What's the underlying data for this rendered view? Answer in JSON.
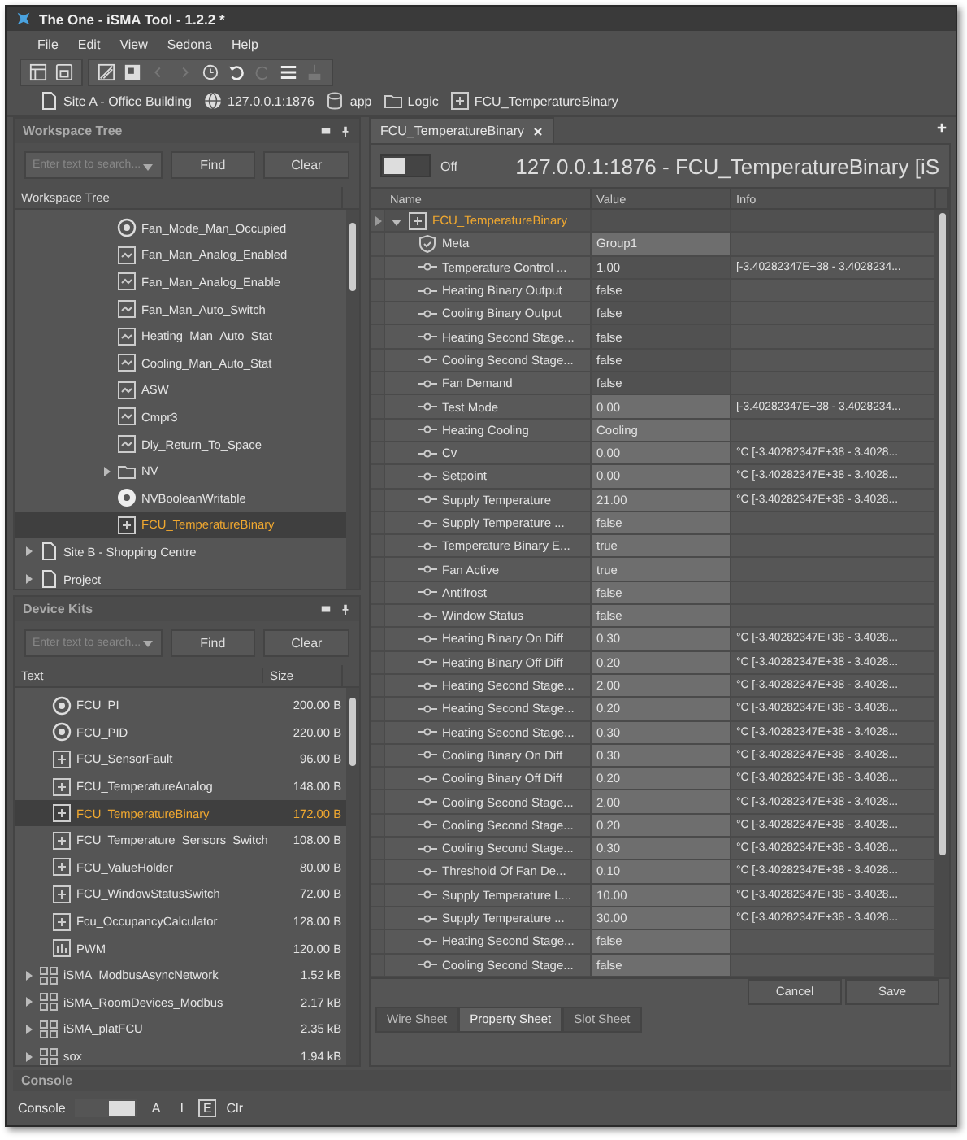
{
  "window": {
    "title": "The One - iSMA Tool - 1.2.2 *"
  },
  "menu": [
    "File",
    "Edit",
    "View",
    "Sedona",
    "Help"
  ],
  "breadcrumb": [
    {
      "label": "Site A - Office Building",
      "kind": "page"
    },
    {
      "label": "127.0.0.1:1876",
      "kind": "device"
    },
    {
      "label": "app",
      "kind": "database"
    },
    {
      "label": "Logic",
      "kind": "folder"
    },
    {
      "label": "FCU_TemperatureBinary",
      "kind": "component"
    }
  ],
  "workspace_tree": {
    "title": "Workspace Tree",
    "search": {
      "placeholder": "Enter text to search..."
    },
    "find": "Find",
    "clear": "Clear",
    "columns": [
      "Workspace Tree"
    ],
    "branch_items": [
      {
        "label": "Fan_Mode_Man_Occupied",
        "kind": "numeric",
        "selected": false
      },
      {
        "label": "Fan_Man_Analog_Enabled",
        "kind": "logic",
        "selected": false
      },
      {
        "label": "Fan_Man_Analog_Enable",
        "kind": "logic",
        "selected": false
      },
      {
        "label": "Fan_Man_Auto_Switch",
        "kind": "logic",
        "selected": false
      },
      {
        "label": "Heating_Man_Auto_Stat",
        "kind": "logic",
        "selected": false
      },
      {
        "label": "Cooling_Man_Auto_Stat",
        "kind": "logic",
        "selected": false
      },
      {
        "label": "ASW",
        "kind": "logic",
        "selected": false
      },
      {
        "label": "Cmpr3",
        "kind": "logic",
        "selected": false
      },
      {
        "label": "Dly_Return_To_Space",
        "kind": "logic",
        "selected": false
      },
      {
        "label": "NV",
        "kind": "folder",
        "expanded": false,
        "selected": false
      },
      {
        "label": "NVBooleanWritable",
        "kind": "boolean",
        "selected": false
      },
      {
        "label": "FCU_TemperatureBinary",
        "kind": "component",
        "selected": true
      }
    ],
    "root_items": [
      {
        "label": "Site B - Shopping Centre",
        "kind": "page",
        "expanded": false,
        "selected": false
      },
      {
        "label": "Project",
        "kind": "page",
        "expanded": false,
        "selected": false
      }
    ]
  },
  "device_kits": {
    "title": "Device Kits",
    "search": {
      "placeholder": "Enter text to search..."
    },
    "find": "Find",
    "clear": "Clear",
    "columns": [
      "Text",
      "Size"
    ],
    "branch_items": [
      {
        "label": "FCU_PI",
        "size": "200.00 B",
        "kind": "numeric",
        "selected": false
      },
      {
        "label": "FCU_PID",
        "size": "220.00 B",
        "kind": "numeric",
        "selected": false
      },
      {
        "label": "FCU_SensorFault",
        "size": "96.00 B",
        "kind": "component",
        "selected": false
      },
      {
        "label": "FCU_TemperatureAnalog",
        "size": "148.00 B",
        "kind": "component",
        "selected": false
      },
      {
        "label": "FCU_TemperatureBinary",
        "size": "172.00 B",
        "kind": "component",
        "selected": true
      },
      {
        "label": "FCU_Temperature_Sensors_Switch",
        "size": "108.00 B",
        "kind": "component",
        "selected": false
      },
      {
        "label": "FCU_ValueHolder",
        "size": "80.00 B",
        "kind": "component",
        "selected": false
      },
      {
        "label": "FCU_WindowStatusSwitch",
        "size": "72.00 B",
        "kind": "component",
        "selected": false
      },
      {
        "label": "Fcu_OccupancyCalculator",
        "size": "128.00 B",
        "kind": "component",
        "selected": false
      },
      {
        "label": "PWM",
        "size": "120.00 B",
        "kind": "pwm",
        "selected": false
      }
    ],
    "root_items": [
      {
        "label": "iSMA_ModbusAsyncNetwork",
        "size": "1.52 kB",
        "kind": "kit",
        "expanded": false,
        "selected": false
      },
      {
        "label": "iSMA_RoomDevices_Modbus",
        "size": "2.17 kB",
        "kind": "kit",
        "expanded": false,
        "selected": false
      },
      {
        "label": "iSMA_platFCU",
        "size": "2.35 kB",
        "kind": "kit",
        "expanded": false,
        "selected": false
      },
      {
        "label": "sox",
        "size": "1.94 kB",
        "kind": "kit",
        "expanded": false,
        "selected": false
      }
    ]
  },
  "editor": {
    "tabs": [
      {
        "label": "FCU_TemperatureBinary",
        "selected": true
      }
    ],
    "toggle": {
      "on": false,
      "label": "Off"
    },
    "title": "127.0.0.1:1876 - FCU_TemperatureBinary [iS",
    "columns": [
      "Name",
      "Value",
      "Info"
    ],
    "root": {
      "name": "FCU_TemperatureBinary",
      "expanded": true,
      "children": [
        {
          "name": "Meta",
          "value": "Group1",
          "kind": "meta",
          "editable": true
        },
        {
          "name": "Temperature Control ...",
          "value": "1.00",
          "info": "[-3.40282347E+38 - 3.4028234...",
          "kind": "slot",
          "editable": false
        },
        {
          "name": "Heating Binary Output",
          "value": "false",
          "kind": "slot",
          "editable": false
        },
        {
          "name": "Cooling Binary Output",
          "value": "false",
          "kind": "slot",
          "editable": false
        },
        {
          "name": "Heating Second Stage...",
          "value": "false",
          "kind": "slot",
          "editable": false
        },
        {
          "name": "Cooling Second Stage...",
          "value": "false",
          "kind": "slot",
          "editable": false
        },
        {
          "name": "Fan Demand",
          "value": "false",
          "kind": "slot",
          "editable": false
        },
        {
          "name": "Test Mode",
          "value": "0.00",
          "info": "[-3.40282347E+38 - 3.4028234...",
          "kind": "slot",
          "editable": true
        },
        {
          "name": "Heating Cooling",
          "value": "Cooling",
          "kind": "slot",
          "editable": true
        },
        {
          "name": "Cv",
          "value": "0.00",
          "info": "°C [-3.40282347E+38 - 3.4028...",
          "kind": "slot",
          "editable": true
        },
        {
          "name": "Setpoint",
          "value": "0.00",
          "info": "°C [-3.40282347E+38 - 3.4028...",
          "kind": "slot",
          "editable": true
        },
        {
          "name": "Supply Temperature",
          "value": "21.00",
          "info": "°C [-3.40282347E+38 - 3.4028...",
          "kind": "slot",
          "editable": true
        },
        {
          "name": "Supply Temperature ...",
          "value": "false",
          "kind": "slot",
          "editable": true
        },
        {
          "name": "Temperature Binary E...",
          "value": "true",
          "kind": "slot",
          "editable": true
        },
        {
          "name": "Fan Active",
          "value": "true",
          "kind": "slot",
          "editable": true
        },
        {
          "name": "Antifrost",
          "value": "false",
          "kind": "slot",
          "editable": true
        },
        {
          "name": "Window Status",
          "value": "false",
          "kind": "slot",
          "editable": true
        },
        {
          "name": "Heating Binary On Diff",
          "value": "0.30",
          "info": "°C [-3.40282347E+38 - 3.4028...",
          "kind": "slot",
          "editable": true
        },
        {
          "name": "Heating Binary Off Diff",
          "value": "0.20",
          "info": "°C [-3.40282347E+38 - 3.4028...",
          "kind": "slot",
          "editable": true
        },
        {
          "name": "Heating Second Stage...",
          "value": "2.00",
          "info": "°C [-3.40282347E+38 - 3.4028...",
          "kind": "slot",
          "editable": true
        },
        {
          "name": "Heating Second Stage...",
          "value": "0.20",
          "info": "°C [-3.40282347E+38 - 3.4028...",
          "kind": "slot",
          "editable": true
        },
        {
          "name": "Heating Second Stage...",
          "value": "0.30",
          "info": "°C [-3.40282347E+38 - 3.4028...",
          "kind": "slot",
          "editable": true
        },
        {
          "name": "Cooling Binary On Diff",
          "value": "0.30",
          "info": "°C [-3.40282347E+38 - 3.4028...",
          "kind": "slot",
          "editable": true
        },
        {
          "name": "Cooling Binary Off Diff",
          "value": "0.20",
          "info": "°C [-3.40282347E+38 - 3.4028...",
          "kind": "slot",
          "editable": true
        },
        {
          "name": "Cooling Second Stage...",
          "value": "2.00",
          "info": "°C [-3.40282347E+38 - 3.4028...",
          "kind": "slot",
          "editable": true
        },
        {
          "name": "Cooling Second Stage...",
          "value": "0.20",
          "info": "°C [-3.40282347E+38 - 3.4028...",
          "kind": "slot",
          "editable": true
        },
        {
          "name": "Cooling Second Stage...",
          "value": "0.30",
          "info": "°C [-3.40282347E+38 - 3.4028...",
          "kind": "slot",
          "editable": true
        },
        {
          "name": "Threshold Of Fan De...",
          "value": "0.10",
          "info": "°C [-3.40282347E+38 - 3.4028...",
          "kind": "slot",
          "editable": true
        },
        {
          "name": "Supply Temperature L...",
          "value": "10.00",
          "info": "°C [-3.40282347E+38 - 3.4028...",
          "kind": "slot",
          "editable": true
        },
        {
          "name": "Supply Temperature ...",
          "value": "30.00",
          "info": "°C [-3.40282347E+38 - 3.4028...",
          "kind": "slot",
          "editable": true
        },
        {
          "name": "Heating Second Stage...",
          "value": "false",
          "kind": "slot",
          "editable": true
        },
        {
          "name": "Cooling Second Stage...",
          "value": "false",
          "kind": "slot",
          "editable": true
        }
      ]
    },
    "buttons": [
      "Cancel",
      "Save"
    ],
    "view_tabs": [
      {
        "label": "Wire Sheet",
        "selected": false
      },
      {
        "label": "Property Sheet",
        "selected": true
      },
      {
        "label": "Slot Sheet",
        "selected": false
      }
    ]
  },
  "console": {
    "title": "Console",
    "label": "Console",
    "toggle": {
      "on": true
    },
    "filters": [
      {
        "label": "A",
        "selected": false
      },
      {
        "label": "I",
        "selected": false
      },
      {
        "label": "E",
        "selected": true
      }
    ],
    "clear": "Clr"
  }
}
